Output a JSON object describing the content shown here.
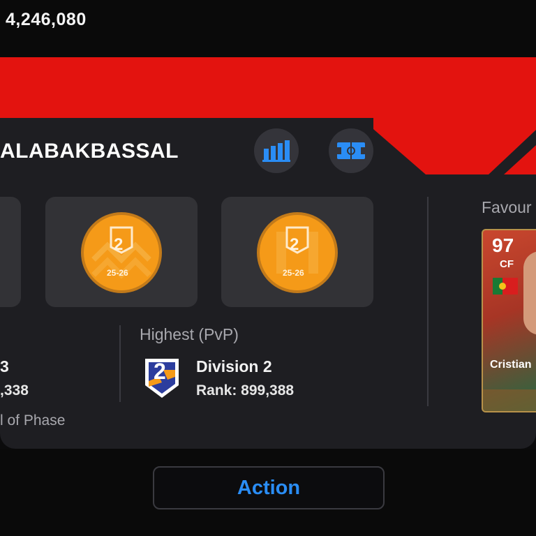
{
  "header": {
    "coins": "4,246,080"
  },
  "profile": {
    "name": "ALABAKBASSAL"
  },
  "badges": [
    {
      "division": "2",
      "season": "25-26"
    },
    {
      "division": "2",
      "season": "25-26"
    }
  ],
  "stats": {
    "left": {
      "division_partial": "3",
      "rank_partial": ",338",
      "phase_label": "l of Phase"
    },
    "highest": {
      "label": "Highest (PvP)",
      "division": "Division 2",
      "rank": "Rank: 899,388",
      "badge_number": "2"
    }
  },
  "favourite": {
    "label": "Favour",
    "rating": "97",
    "position": "CF",
    "name_partial": "Cristian"
  },
  "footer": {
    "action_label": "Action"
  },
  "colors": {
    "accent_blue": "#2a8df5",
    "band_red": "#e3130f",
    "card_bg": "#1e1e22"
  }
}
